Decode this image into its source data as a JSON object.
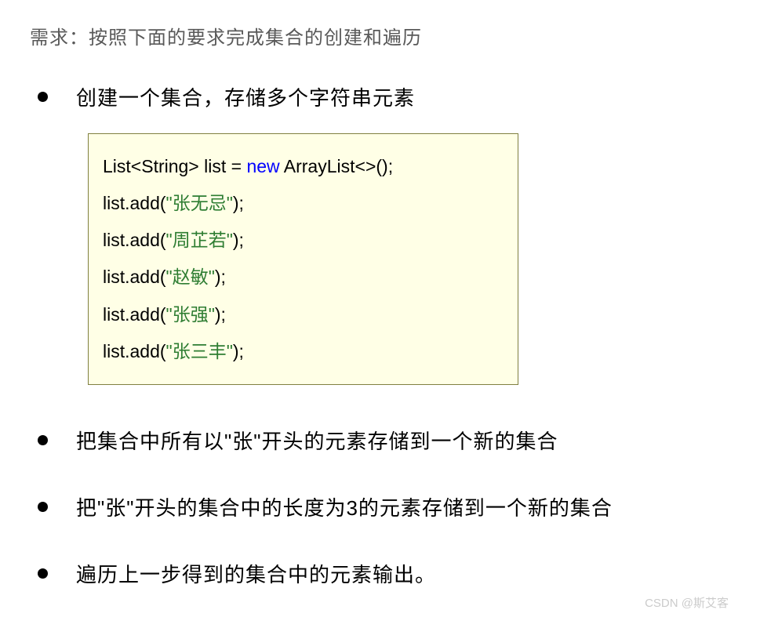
{
  "intro": "需求：按照下面的要求完成集合的创建和遍历",
  "bullets": {
    "b1": "创建一个集合，存储多个字符串元素",
    "b2": "把集合中所有以\"张\"开头的元素存储到一个新的集合",
    "b3": "把\"张\"开头的集合中的长度为3的元素存储到一个新的集合",
    "b4": "遍历上一步得到的集合中的元素输出。"
  },
  "code": {
    "l1_a": "List<String> list = ",
    "l1_new": "new",
    "l1_b": " ArrayList<>();",
    "l2_a": "list.add(",
    "l2_s": "\"张无忌\"",
    "l2_b": ");",
    "l3_a": "list.add(",
    "l3_s": "\"周芷若\"",
    "l3_b": ");",
    "l4_a": "list.add(",
    "l4_s": "\"赵敏\"",
    "l4_b": ");",
    "l5_a": "list.add(",
    "l5_s": "\"张强\"",
    "l5_b": ");",
    "l6_a": "list.add(",
    "l6_s": "\"张三丰\"",
    "l6_b": ");"
  },
  "watermark": "CSDN @斯艾客"
}
